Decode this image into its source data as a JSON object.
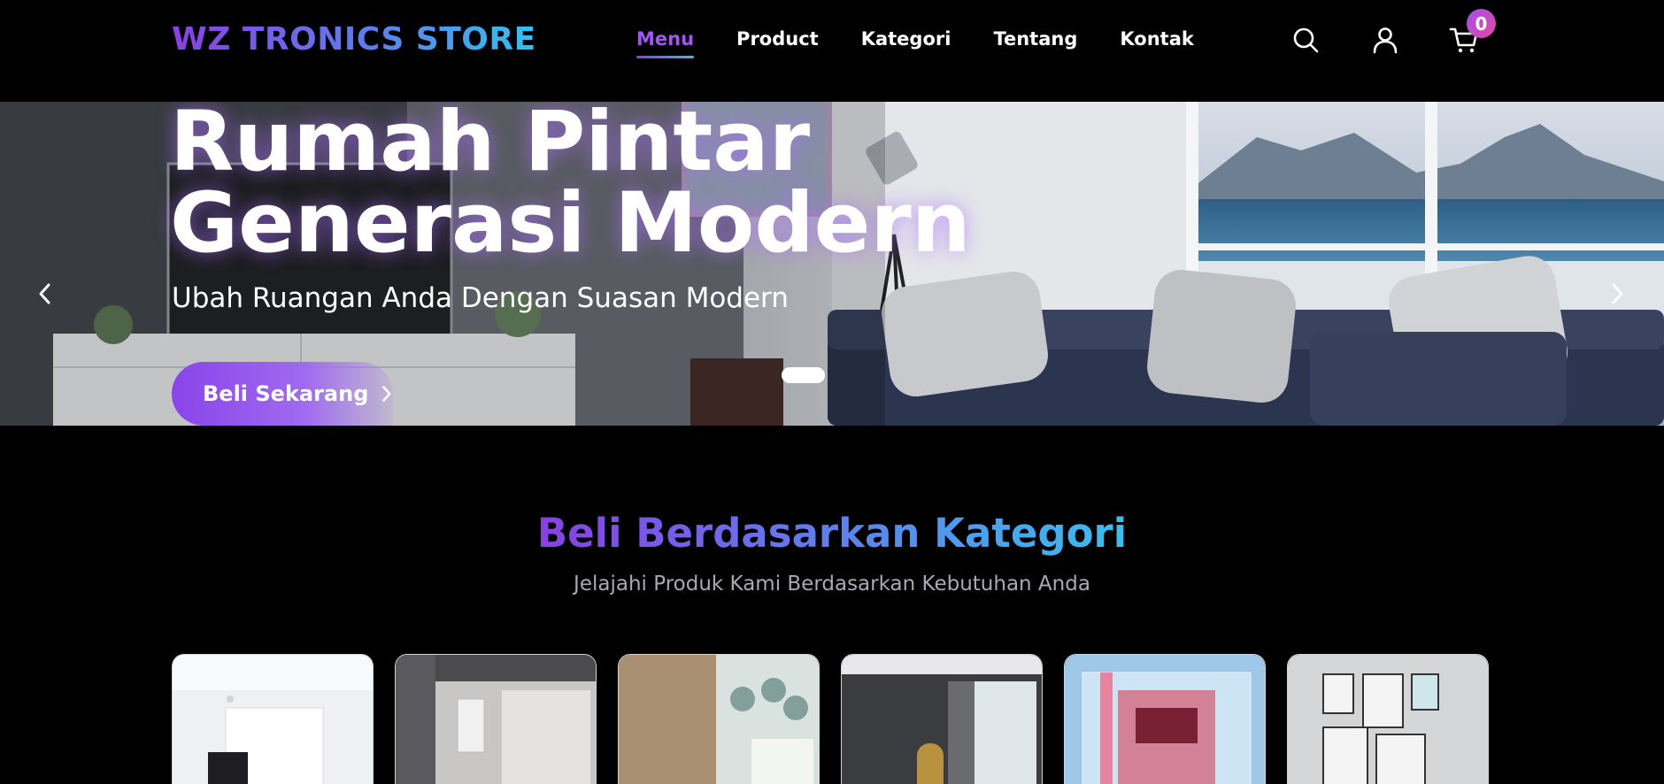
{
  "header": {
    "logo": "WZ TRONICS STORE",
    "nav": [
      "Menu",
      "Product",
      "Kategori",
      "Tentang",
      "Kontak"
    ],
    "active_nav": "Menu",
    "icons": [
      "search-icon",
      "user-icon",
      "cart-icon"
    ],
    "cart_count": "0"
  },
  "hero": {
    "title_line1": "Rumah Pintar",
    "title_line2": "Generasi Modern",
    "subtitle": "Ubah Ruangan Anda Dengan Suasan Modern",
    "cta_label": "Beli Sekarang",
    "slide_count": 1,
    "active_slide": 1
  },
  "categories": {
    "title": "Beli Berdasarkan Kategori",
    "subtitle": "Jelajahi Produk Kami Berdasarkan Kebutuhan Anda",
    "card_count": 6
  },
  "colors": {
    "accent_purple": "#8b3fe6",
    "accent_blue": "#2ec4f0",
    "badge_pink": "#e8479e",
    "background": "#000000"
  }
}
